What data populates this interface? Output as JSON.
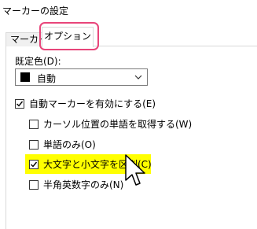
{
  "window": {
    "title": "マーカーの設定"
  },
  "tabs": [
    {
      "label": "マーカー",
      "selected": false
    },
    {
      "label": "オプション",
      "selected": true
    }
  ],
  "highlight_color": "#e8457a",
  "default_color": {
    "label": "既定色(D):",
    "value": "自動",
    "swatch_color": "#000000",
    "icon": "chevron-down-icon"
  },
  "options": {
    "auto_marker": {
      "label": "自動マーカーを有効にする(E)",
      "checked": true
    },
    "cursor_word": {
      "label": "カーソル位置の単語を取得する(W)",
      "checked": false
    },
    "word_only": {
      "label": "単語のみ(O)",
      "checked": false
    },
    "match_case": {
      "label": "大文字と小文字を区別(C)",
      "checked": true,
      "highlight": "#ffff00"
    },
    "halfwidth_alnum_only": {
      "label": "半角英数字のみ(N)",
      "checked": false
    }
  },
  "pointer_icon": "mouse-pointer-icon"
}
